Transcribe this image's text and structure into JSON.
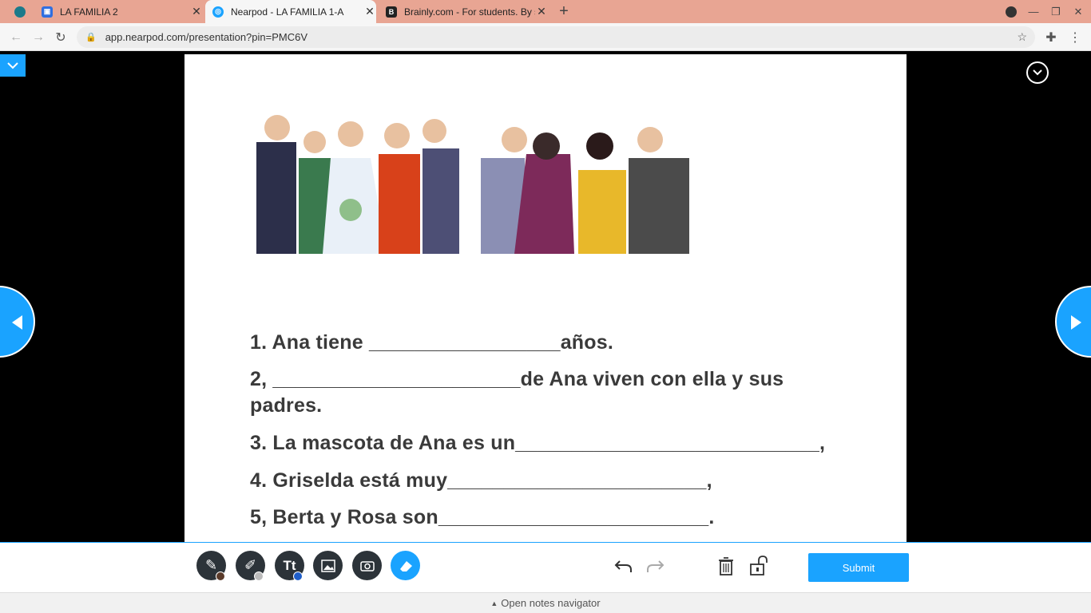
{
  "browser": {
    "tabs": [
      {
        "title": "LA FAMILIA 2",
        "favicon": "slides-icon"
      },
      {
        "title": "Nearpod - LA FAMILIA 1-A",
        "favicon": "nearpod-icon"
      },
      {
        "title": "Brainly.com - For students. By st",
        "favicon": "brainly-icon"
      }
    ],
    "url": "app.nearpod.com/presentation?pin=PMC6V"
  },
  "slide": {
    "questions": [
      "1. Ana tiene _________________años.",
      "2, ______________________de Ana viven con ella y sus",
      "padres.",
      "3. La mascota de Ana es un___________________________,",
      "4. Griselda está muy_______________________,",
      "5, Berta y Rosa son________________________."
    ]
  },
  "toolbar": {
    "submit_label": "Submit",
    "notes_label": "Open notes navigator",
    "accent": "#1aa3ff"
  }
}
